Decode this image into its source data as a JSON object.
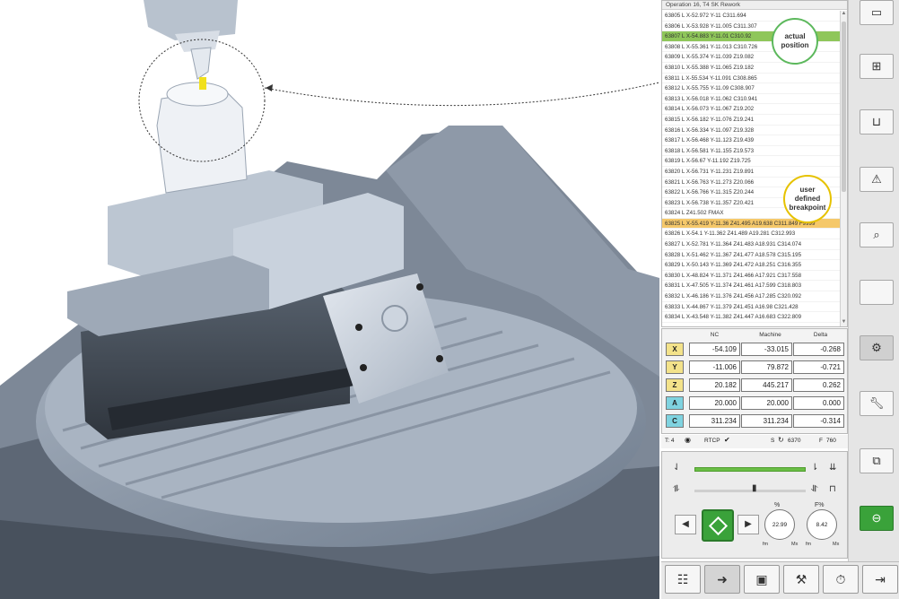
{
  "nc_program": {
    "header": "Operation 16, T4 SK Rework",
    "lines": [
      "63805 L X-52.972 Y-11 C311.694",
      "63806 L X-53.928 Y-11.005 C311.307",
      "63807 L X-54.883 Y-11.01 C310.92",
      "63808 L X-55.361 Y-11.013 C310.726",
      "63809 L X-55.374 Y-11.039 Z19.082",
      "63810 L X-55.388 Y-11.065 Z19.182",
      "63811 L X-55.534 Y-11.091 C308.865",
      "63812 L X-55.755 Y-11.09 C308.907",
      "63813 L X-56.018 Y-11.062 C310.941",
      "63814 L X-56.073 Y-11.067 Z19.202",
      "63815 L X-56.182 Y-11.076 Z19.241",
      "63816 L X-56.334 Y-11.097 Z19.328",
      "63817 L X-56.468 Y-11.123 Z19.439",
      "63818 L X-56.581 Y-11.155 Z19.573",
      "63819 L X-56.67 Y-11.192 Z19.725",
      "63820 L X-56.731 Y-11.231 Z19.891",
      "63821 L X-56.763 Y-11.273 Z20.066",
      "63822 L X-56.766 Y-11.315 Z20.244",
      "63823 L X-56.738 Y-11.357 Z20.421",
      "63824 L Z41.502 FMAX",
      "63825 L X-55.419 Y-11.36 Z41.495 A19.638 C311.849 F9999",
      "63826 L X-54.1 Y-11.362 Z41.489 A19.281 C312.993",
      "63827 L X-52.781 Y-11.364 Z41.483 A18.931 C314.074",
      "63828 L X-51.462 Y-11.367 Z41.477 A18.578 C315.195",
      "63829 L X-50.143 Y-11.369 Z41.472 A18.251 C316.355",
      "63830 L X-48.824 Y-11.371 Z41.466 A17.921 C317.558",
      "63831 L X-47.505 Y-11.374 Z41.461 A17.599 C318.803",
      "63832 L X-46.186 Y-11.376 Z41.456 A17.285 C320.092",
      "63833 L X-44.867 Y-11.379 Z41.451 A16.98 C321.428",
      "63834 L X-43.548 Y-11.382 Z41.447 A16.683 C322.809"
    ],
    "active_index": 2,
    "breakpoint_index": 20,
    "active_color": "#8fc65a",
    "breakpoint_color": "#f5c86a"
  },
  "callouts": {
    "actual_position": "actual position",
    "user_breakpoint": "user defined breakpoint"
  },
  "axes": {
    "headers": [
      "NC",
      "Machine",
      "Delta"
    ],
    "rows": [
      {
        "axis": "X",
        "nc": "-54.109",
        "machine": "-33.015",
        "delta": "-0.268",
        "color": "#f3e28a"
      },
      {
        "axis": "Y",
        "nc": "-11.006",
        "machine": "79.872",
        "delta": "-0.721",
        "color": "#f3e28a"
      },
      {
        "axis": "Z",
        "nc": "20.182",
        "machine": "445.217",
        "delta": "0.262",
        "color": "#f3e28a"
      },
      {
        "axis": "A",
        "nc": "20.000",
        "machine": "20.000",
        "delta": "0.000",
        "color": "#7fd3e0"
      },
      {
        "axis": "C",
        "nc": "311.234",
        "machine": "311.234",
        "delta": "-0.314",
        "color": "#7fd3e0"
      }
    ]
  },
  "status": {
    "tool": "T: 4",
    "rtcp": "RTCP",
    "spindle_label": "S",
    "spindle": "6370",
    "feed_label": "F",
    "feed": "760"
  },
  "controls": {
    "speed_override": "22.99",
    "feed_override": "8.42",
    "speed_dial_title": "%",
    "feed_dial_title": "F%",
    "dial_min": "fm",
    "dial_max": "Mx"
  }
}
